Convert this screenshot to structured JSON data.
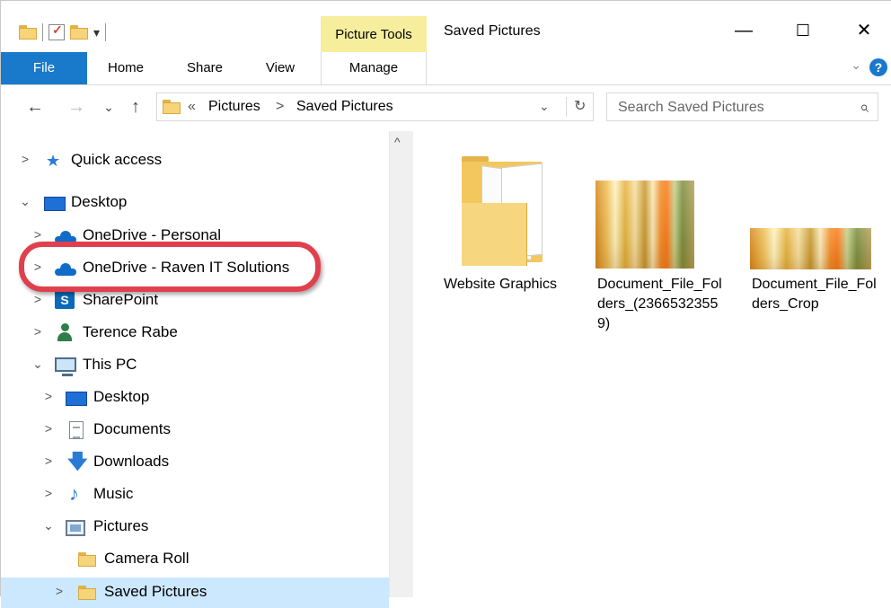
{
  "window": {
    "title": "Saved Pictures",
    "contextual_tab": "Picture Tools",
    "controls": {
      "minimize": "—",
      "maximize": "☐",
      "close": "✕"
    }
  },
  "qat": {
    "dropdown": "▾"
  },
  "ribbon": {
    "tabs": [
      "File",
      "Home",
      "Share",
      "View",
      "Manage"
    ],
    "expand_chevron": "⌄",
    "help": "?"
  },
  "nav": {
    "back": "←",
    "forward": "→",
    "recent": "⌄",
    "up": "↑",
    "address": {
      "overflow": "«",
      "crumbs": [
        "Pictures",
        "Saved Pictures"
      ],
      "separator": ">",
      "dropdown": "⌄",
      "refresh": "↻"
    },
    "search": {
      "placeholder": "Search Saved Pictures",
      "icon": "⌕"
    }
  },
  "tree": {
    "collapsed_chevron": ">",
    "expanded_chevron": "⌄",
    "items": [
      {
        "label": "Quick access",
        "icon": "star-icon"
      },
      {
        "label": "Desktop",
        "icon": "desktop-icon"
      },
      {
        "label": "OneDrive - Personal",
        "icon": "onedrive-icon"
      },
      {
        "label": "OneDrive - Raven IT Solutions",
        "icon": "onedrive-icon"
      },
      {
        "label": "SharePoint",
        "icon": "sharepoint-icon"
      },
      {
        "label": "Terence Rabe",
        "icon": "user-icon"
      },
      {
        "label": "This PC",
        "icon": "pc-icon"
      },
      {
        "label": "Desktop",
        "icon": "desktop-icon"
      },
      {
        "label": "Documents",
        "icon": "documents-icon"
      },
      {
        "label": "Downloads",
        "icon": "downloads-icon"
      },
      {
        "label": "Music",
        "icon": "music-icon"
      },
      {
        "label": "Pictures",
        "icon": "pictures-icon"
      },
      {
        "label": "Camera Roll",
        "icon": "folder-icon"
      },
      {
        "label": "Saved Pictures",
        "icon": "folder-icon"
      }
    ],
    "scroll_up": "^"
  },
  "files": [
    {
      "name": "Website Graphics",
      "type": "folder"
    },
    {
      "name": "Document_File_Folders_(23665323559)",
      "type": "image"
    },
    {
      "name": "Document_File_Folders_Crop",
      "type": "image"
    }
  ],
  "colors": {
    "file_tab": "#1979ca",
    "contextual_tab": "#f6ee9d",
    "selection": "#cce8ff",
    "highlight_ring": "#e0404e"
  }
}
